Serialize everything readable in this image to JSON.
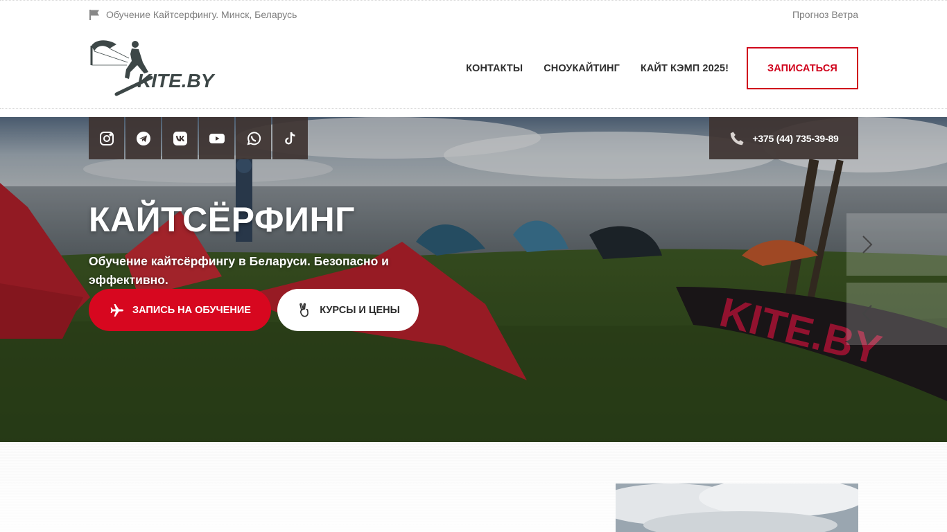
{
  "topbar": {
    "location_text": "Обучение Кайтсерфингу. Минск, Беларусь",
    "wind_link": "Прогноз Ветра"
  },
  "header": {
    "logo_text": "KITE.BY",
    "nav": [
      {
        "label": "КОНТАКТЫ"
      },
      {
        "label": "СНОУКАЙТИНГ"
      },
      {
        "label": "КАЙТ КЭМП 2025!"
      }
    ],
    "cta_label": "ЗАПИСАТЬСЯ"
  },
  "hero": {
    "socials": [
      "instagram-icon",
      "telegram-icon",
      "vk-icon",
      "youtube-icon",
      "whatsapp-icon",
      "tiktok-icon"
    ],
    "phone": "+375 (44) 735-39-89",
    "title": "КАЙТСЁРФИНГ",
    "subtitle": "Обучение кайтсёрфингу в Беларуси. Безопасно и эффективно.",
    "primary_button": "ЗАПИСЬ НА ОБУЧЕНИЕ",
    "secondary_button": "КУРСЫ И ЦЕНЫ",
    "kite_print": "KITE.BY"
  },
  "colors": {
    "accent": "#d7071f",
    "social_bg": "#3e3432",
    "text_dark": "#2f2f2f",
    "text_muted": "#7d7d7d"
  }
}
